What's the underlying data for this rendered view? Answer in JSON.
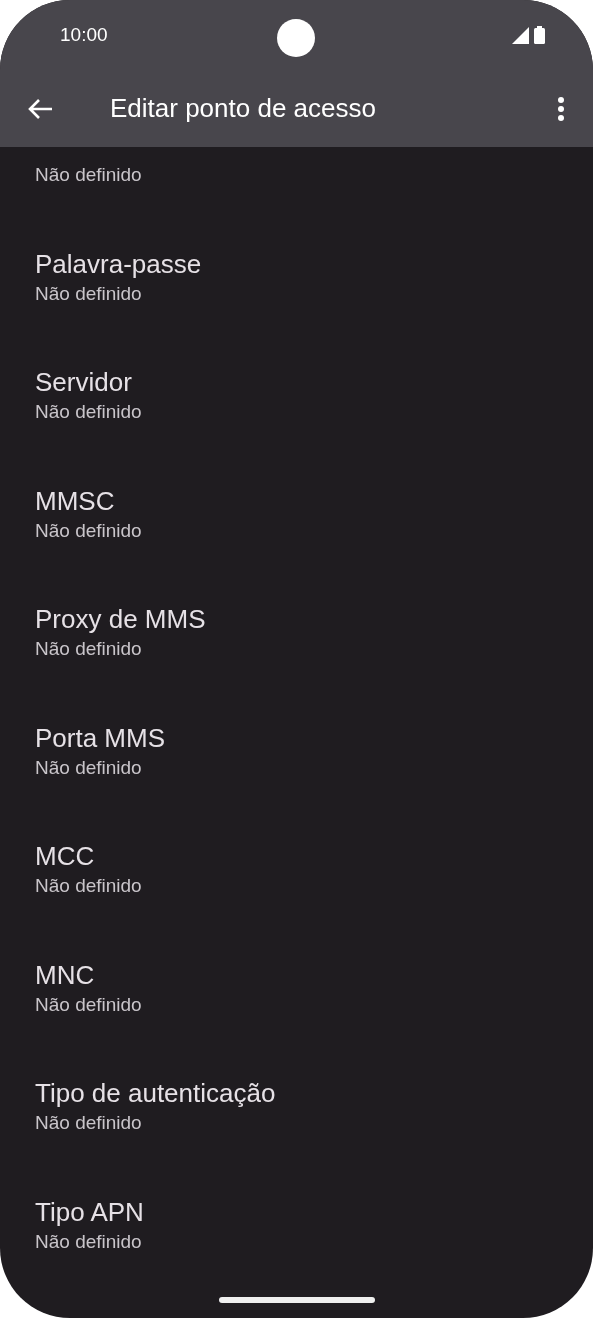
{
  "status_bar": {
    "time": "10:00"
  },
  "toolbar": {
    "title": "Editar ponto de acesso"
  },
  "settings": [
    {
      "value": "Não definido"
    },
    {
      "title": "Palavra-passe",
      "value": "Não definido"
    },
    {
      "title": "Servidor",
      "value": "Não definido"
    },
    {
      "title": "MMSC",
      "value": "Não definido"
    },
    {
      "title": "Proxy de MMS",
      "value": "Não definido"
    },
    {
      "title": "Porta MMS",
      "value": "Não definido"
    },
    {
      "title": "MCC",
      "value": "Não definido"
    },
    {
      "title": "MNC",
      "value": "Não definido"
    },
    {
      "title": "Tipo de autenticação",
      "value": "Não definido"
    },
    {
      "title": "Tipo APN",
      "value": "Não definido"
    }
  ]
}
